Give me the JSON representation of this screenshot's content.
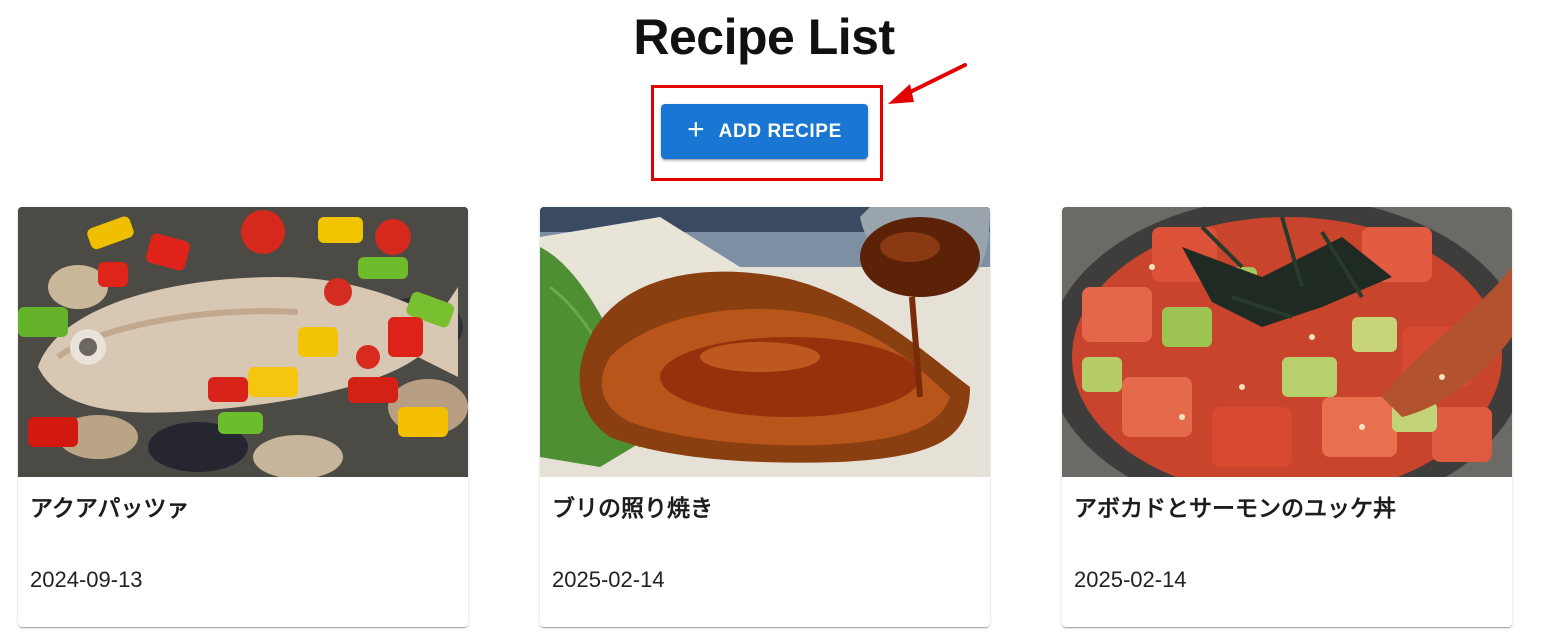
{
  "header": {
    "title": "Recipe List",
    "add_button_label": "ADD RECIPE",
    "add_button_icon": "plus-icon"
  },
  "colors": {
    "primary": "#1976d2",
    "highlight": "#e40000"
  },
  "recipes": [
    {
      "name": "アクアパッツァ",
      "date": "2024-09-13",
      "image": "acqua-pazza-photo"
    },
    {
      "name": "ブリの照り焼き",
      "date": "2025-02-14",
      "image": "yellowtail-teriyaki-photo"
    },
    {
      "name": "アボカドとサーモンのユッケ丼",
      "date": "2025-02-14",
      "image": "avocado-salmon-yukke-bowl-photo"
    }
  ]
}
